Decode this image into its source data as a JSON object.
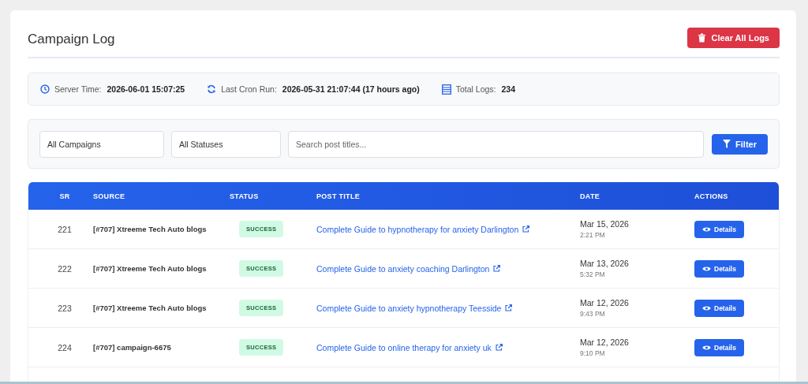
{
  "header": {
    "title": "Campaign Log",
    "clear_button": "Clear All Logs"
  },
  "info": [
    {
      "kind": "clock",
      "label": "Server Time:",
      "value": "2026-06-01 15:07:25"
    },
    {
      "kind": "sync",
      "label": "Last Cron Run:",
      "value": "2026-05-31 21:07:44 (17 hours ago)"
    },
    {
      "kind": "list",
      "label": "Total Logs:",
      "value": "234"
    }
  ],
  "filters": {
    "campaign": "All Campaigns",
    "status": "All Statuses",
    "search_placeholder": "Search post titles...",
    "button": "Filter"
  },
  "table": {
    "columns": [
      "SR",
      "SOURCE",
      "STATUS",
      "POST TITLE",
      "DATE",
      "ACTIONS"
    ],
    "rows": [
      {
        "sr": "221",
        "source": "[#707] Xtreeme Tech Auto blogs",
        "status": "SUCCESS",
        "title": "Complete Guide to hypnotherapy for anxiety Darlington",
        "date": "Mar 15, 2026",
        "time": "2:21 PM",
        "action": "Details"
      },
      {
        "sr": "222",
        "source": "[#707] Xtreeme Tech Auto blogs",
        "status": "SUCCESS",
        "title": "Complete Guide to anxiety coaching Darlington",
        "date": "Mar 13, 2026",
        "time": "5:32 PM",
        "action": "Details"
      },
      {
        "sr": "223",
        "source": "[#707] Xtreeme Tech Auto blogs",
        "status": "SUCCESS",
        "title": "Complete Guide to anxiety hypnotherapy Teesside",
        "date": "Mar 12, 2026",
        "time": "9:43 PM",
        "action": "Details"
      },
      {
        "sr": "224",
        "source": "[#707] campaign-6675",
        "status": "SUCCESS",
        "title": "Complete Guide to online therapy for anxiety uk",
        "date": "Mar 12, 2026",
        "time": "9:10 PM",
        "action": "Details"
      }
    ]
  }
}
